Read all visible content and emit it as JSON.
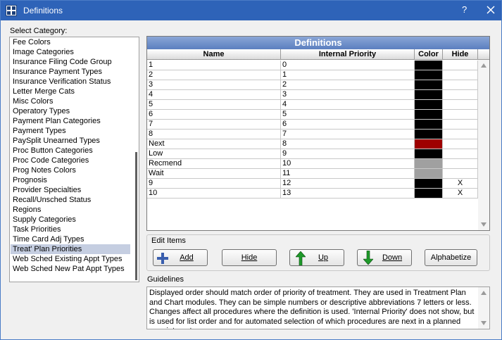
{
  "window": {
    "title": "Definitions",
    "help": "?"
  },
  "category": {
    "label": "Select Category:",
    "items": [
      "Fee Colors",
      "Image Categories",
      "Insurance Filing Code Group",
      "Insurance Payment Types",
      "Insurance Verification Status",
      "Letter Merge Cats",
      "Misc Colors",
      "Operatory Types",
      "Payment Plan Categories",
      "Payment Types",
      "PaySplit Unearned Types",
      "Proc Button Categories",
      "Proc Code Categories",
      "Prog Notes Colors",
      "Prognosis",
      "Provider Specialties",
      "Recall/Unsched Status",
      "Regions",
      "Supply Categories",
      "Task Priorities",
      "Time Card Adj Types",
      "Treat' Plan Priorities",
      "Web Sched Existing Appt Types",
      "Web Sched New Pat Appt Types"
    ],
    "selected": "Treat' Plan Priorities"
  },
  "grid": {
    "title": "Definitions",
    "columns": [
      "Name",
      "Internal Priority",
      "Color",
      "Hide"
    ],
    "rows": [
      {
        "name": "1",
        "priority": "0",
        "color": "#000000",
        "hide": ""
      },
      {
        "name": "2",
        "priority": "1",
        "color": "#000000",
        "hide": ""
      },
      {
        "name": "3",
        "priority": "2",
        "color": "#000000",
        "hide": ""
      },
      {
        "name": "4",
        "priority": "3",
        "color": "#000000",
        "hide": ""
      },
      {
        "name": "5",
        "priority": "4",
        "color": "#000000",
        "hide": ""
      },
      {
        "name": "6",
        "priority": "5",
        "color": "#000000",
        "hide": ""
      },
      {
        "name": "7",
        "priority": "6",
        "color": "#000000",
        "hide": ""
      },
      {
        "name": "8",
        "priority": "7",
        "color": "#000000",
        "hide": ""
      },
      {
        "name": "Next",
        "priority": "8",
        "color": "#9e0000",
        "hide": ""
      },
      {
        "name": "Low",
        "priority": "9",
        "color": "#000000",
        "hide": ""
      },
      {
        "name": "Recmend",
        "priority": "10",
        "color": "#a0a0a0",
        "hide": ""
      },
      {
        "name": "Wait",
        "priority": "11",
        "color": "#a0a0a0",
        "hide": ""
      },
      {
        "name": "9",
        "priority": "12",
        "color": "#000000",
        "hide": "X"
      },
      {
        "name": "10",
        "priority": "13",
        "color": "#000000",
        "hide": "X"
      }
    ]
  },
  "edit_items": {
    "label": "Edit Items",
    "add": "Add",
    "hide": "Hide",
    "up": "Up",
    "down": "Down",
    "alphabetize": "Alphabetize"
  },
  "guidelines": {
    "label": "Guidelines",
    "text": "Displayed order should match order of priority of treatment.  They are used in Treatment Plan and Chart modules. They can be simple numbers or descriptive abbreviations 7 letters or less.  Changes affect all procedures where the definition is used.  'Internal Priority' does not show, but is used for list order and for automated selection of which procedures are next in a planned appointment."
  },
  "colors": {
    "title_bar": "#2e63b8",
    "grid_header": "#5b7fc0",
    "selection": "#c5cee1"
  }
}
